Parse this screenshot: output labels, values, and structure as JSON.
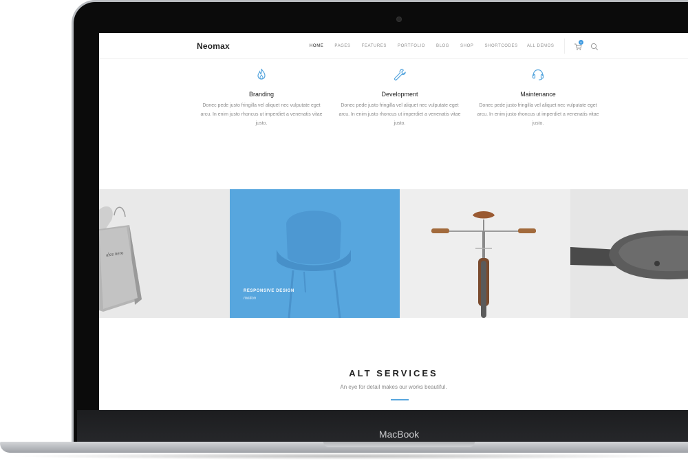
{
  "device": {
    "label": "MacBook"
  },
  "site": {
    "logo": "Neomax",
    "nav": [
      {
        "label": "HOME",
        "active": true
      },
      {
        "label": "PAGES",
        "active": false
      },
      {
        "label": "FEATURES",
        "active": false
      },
      {
        "label": "PORTFOLIO",
        "active": false
      },
      {
        "label": "BLOG",
        "active": false
      },
      {
        "label": "SHOP",
        "active": false
      },
      {
        "label": "SHORTCODES",
        "active": false
      }
    ],
    "demos_label": "ALL DEMOS",
    "cart_count": "0",
    "icons": {
      "cart": "cart-icon",
      "search": "search-icon"
    }
  },
  "services": [
    {
      "icon": "flame-icon",
      "title": "Branding",
      "text": "Donec pede justo fringilla vel aliquet nec vulputate eget arcu. In enim justo rhoncus ut imperdiet a venenatis vitae justo."
    },
    {
      "icon": "wrench-icon",
      "title": "Development",
      "text": "Donec pede justo fringilla vel aliquet nec vulputate eget arcu. In enim justo rhoncus ut imperdiet a venenatis vitae justo."
    },
    {
      "icon": "headset-icon",
      "title": "Maintenance",
      "text": "Donec pede justo fringilla vel aliquet nec vulputate eget arcu. In enim justo rhoncus ut imperdiet a venenatis vitae justo."
    }
  ],
  "portfolio": {
    "bag_text": "alce nero",
    "featured": {
      "title": "RESPONSIVE DESIGN",
      "category": "motion"
    }
  },
  "alt_services": {
    "title": "ALT SERVICES",
    "subtitle": "An eye for detail makes our works beautiful."
  },
  "colors": {
    "accent": "#57a6de",
    "badge": "#3f9ae0",
    "text": "#222222",
    "muted": "#8a8a8a"
  }
}
